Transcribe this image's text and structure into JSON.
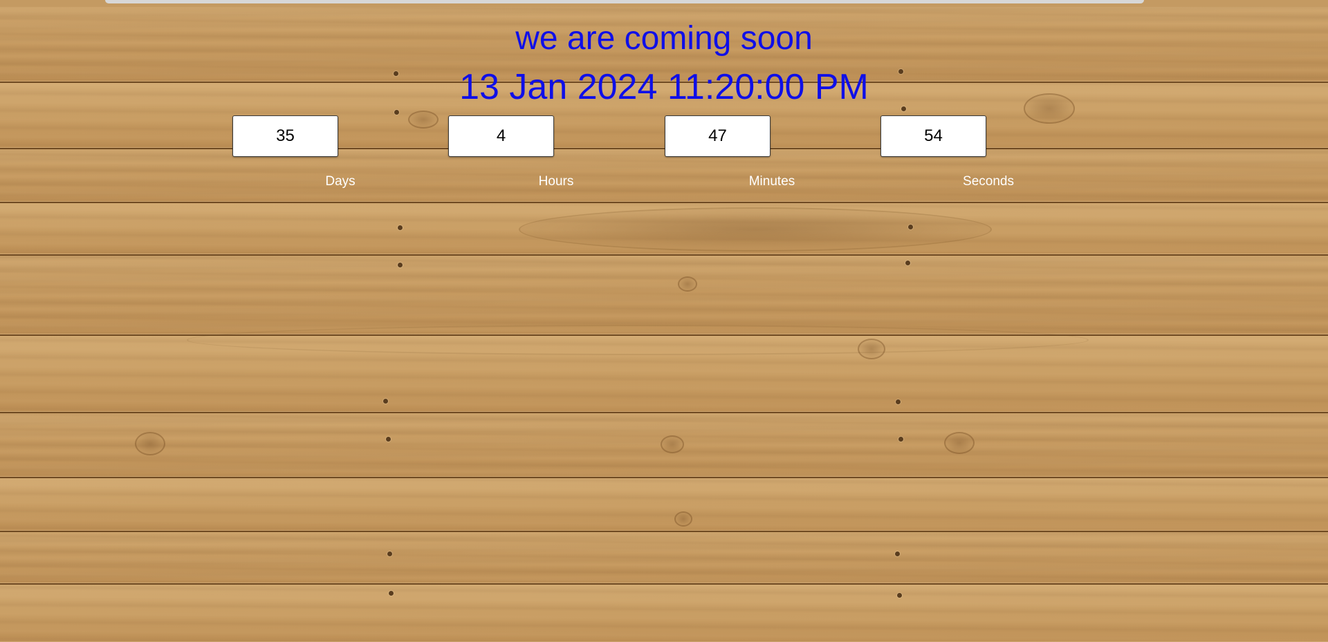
{
  "page": {
    "title": "we are coming soon",
    "target_date": "13 Jan 2024 11:20:00 PM"
  },
  "countdown": {
    "days": {
      "value": "35",
      "label": "Days"
    },
    "hours": {
      "value": "4",
      "label": "Hours"
    },
    "minutes": {
      "value": "47",
      "label": "Minutes"
    },
    "seconds": {
      "value": "54",
      "label": "Seconds"
    }
  },
  "colors": {
    "heading": "#0f0fe8",
    "label": "#ffffff",
    "background_wood": "#c49a62"
  }
}
